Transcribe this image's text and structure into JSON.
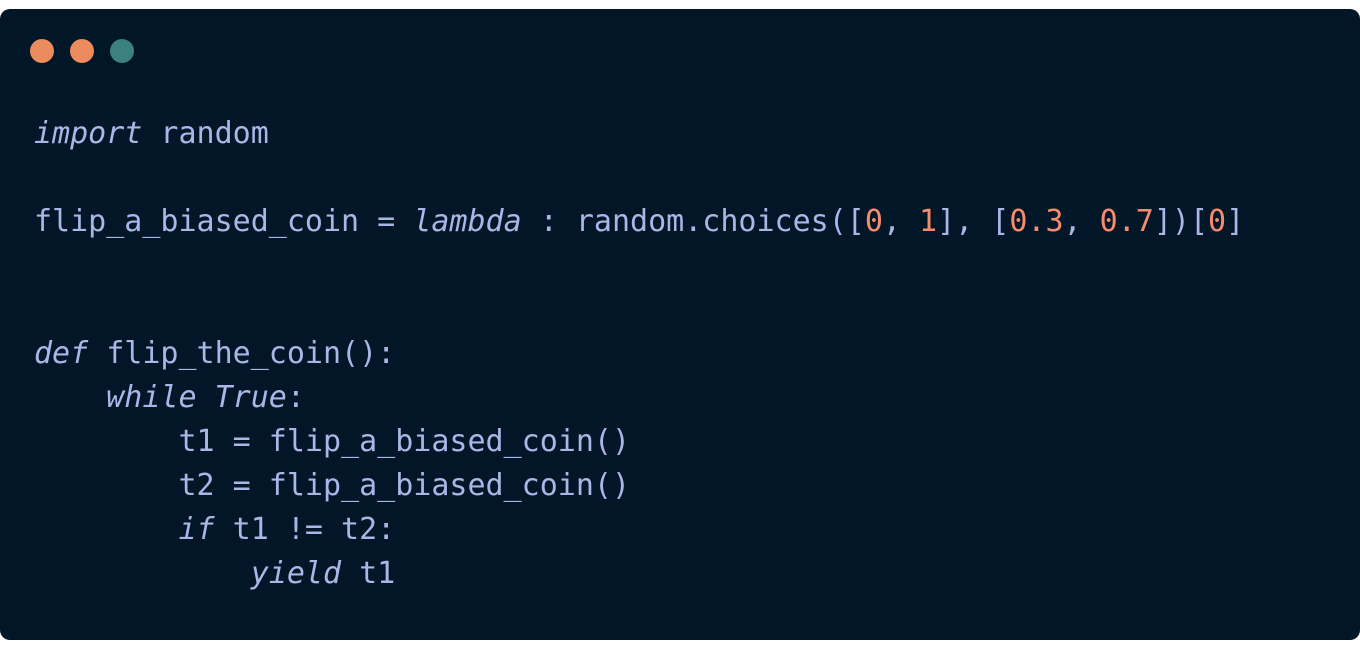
{
  "window": {
    "background": "#011627",
    "controls": [
      {
        "name": "close",
        "color": "#ec8b5e"
      },
      {
        "name": "minimize",
        "color": "#ec8b5e"
      },
      {
        "name": "zoom",
        "color": "#3d8080"
      }
    ]
  },
  "code": {
    "language": "python",
    "colors": {
      "text": "#a9b6e6",
      "number": "#f78c6c"
    },
    "lines": [
      [
        {
          "t": "import",
          "k": "kw"
        },
        {
          "t": " random"
        }
      ],
      [],
      [
        {
          "t": "flip_a_biased_coin = "
        },
        {
          "t": "lambda",
          "k": "kw"
        },
        {
          "t": " : random.choices(["
        },
        {
          "t": "0",
          "k": "num"
        },
        {
          "t": ", "
        },
        {
          "t": "1",
          "k": "num"
        },
        {
          "t": "], ["
        },
        {
          "t": "0.3",
          "k": "num"
        },
        {
          "t": ", "
        },
        {
          "t": "0.7",
          "k": "num"
        },
        {
          "t": "])["
        },
        {
          "t": "0",
          "k": "num"
        },
        {
          "t": "]"
        }
      ],
      [],
      [],
      [
        {
          "t": "def",
          "k": "kw"
        },
        {
          "t": " flip_the_coin():"
        }
      ],
      [
        {
          "t": "    "
        },
        {
          "t": "while",
          "k": "kw"
        },
        {
          "t": " "
        },
        {
          "t": "True",
          "k": "kw"
        },
        {
          "t": ":"
        }
      ],
      [
        {
          "t": "        t1 = flip_a_biased_coin()"
        }
      ],
      [
        {
          "t": "        t2 = flip_a_biased_coin()"
        }
      ],
      [
        {
          "t": "        "
        },
        {
          "t": "if",
          "k": "kw"
        },
        {
          "t": " t1 != t2:"
        }
      ],
      [
        {
          "t": "            "
        },
        {
          "t": "yield",
          "k": "kw"
        },
        {
          "t": " t1"
        }
      ]
    ]
  }
}
